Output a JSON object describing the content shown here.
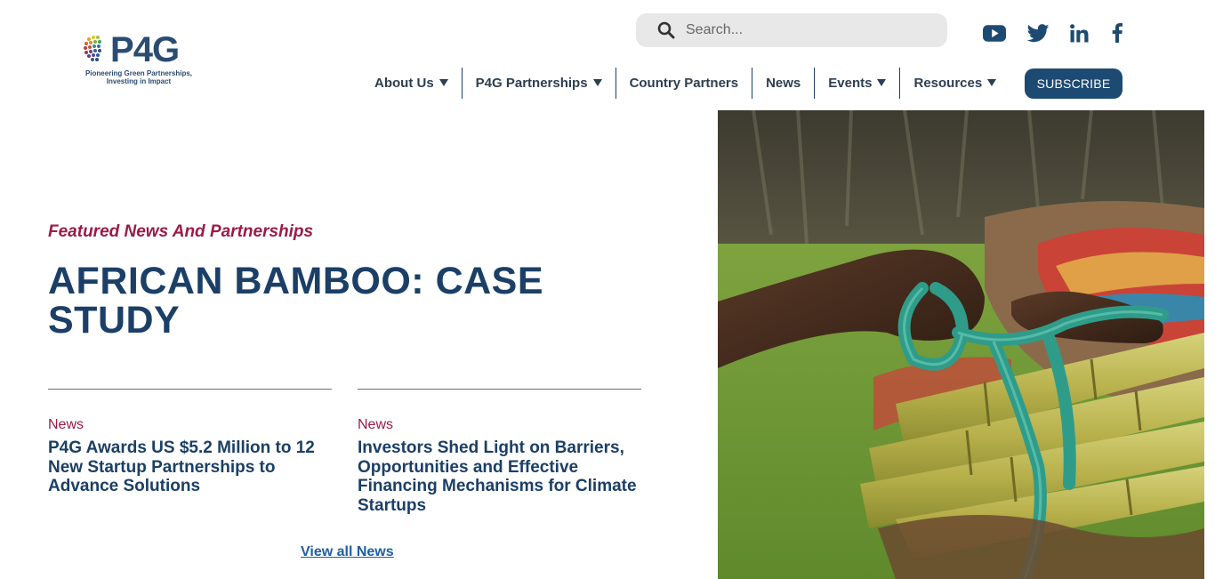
{
  "logo": {
    "word_p": "P",
    "word_four": "4",
    "word_g": "G",
    "tagline_1": "Pioneering Green Partnerships,",
    "tagline_2": "Investing in Impact"
  },
  "search": {
    "placeholder": "Search..."
  },
  "social": [
    "youtube-icon",
    "twitter-icon",
    "linkedin-icon",
    "facebook-icon"
  ],
  "nav": {
    "items": [
      {
        "label": "About Us",
        "dropdown": true
      },
      {
        "label": "P4G Partnerships",
        "dropdown": true
      },
      {
        "label": "Country Partners",
        "dropdown": false
      },
      {
        "label": "News",
        "dropdown": false
      },
      {
        "label": "Events",
        "dropdown": true
      },
      {
        "label": "Resources",
        "dropdown": true
      }
    ],
    "subscribe_label": "SUBSCRIBE"
  },
  "main": {
    "eyebrow": "Featured News And Partnerships",
    "headline": "African Bamboo: Case Study",
    "cards": [
      {
        "category": "News",
        "title": "P4G Awards US $5.2 Million to 12 New Startup Partnerships to Advance Solutions"
      },
      {
        "category": "News",
        "title": "Investors Shed Light on Barriers, Opportunities and Effective Financing Mechanisms for Climate Startups"
      }
    ],
    "view_all": "View all News"
  },
  "colors": {
    "brand_navy": "#1b3f66",
    "accent_maroon": "#9a1b46",
    "subscribe_bg": "#1d4a72",
    "link_blue": "#1f5ea5"
  }
}
